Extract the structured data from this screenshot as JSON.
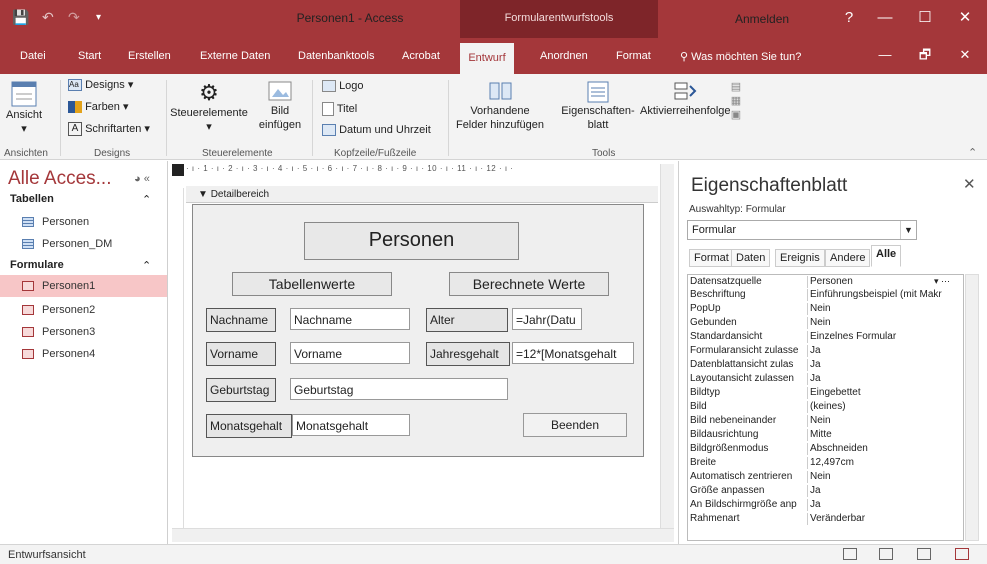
{
  "app": {
    "title": "Personen1 - Access",
    "context_tab_group": "Formularentwurfstools",
    "signin": "Anmelden",
    "help": "?",
    "minimize": "—",
    "restore": "☐",
    "close": "✕",
    "ribbon_restore": "🗗",
    "ribbon_close": "✕"
  },
  "tabs": [
    "Datei",
    "Start",
    "Erstellen",
    "Externe Daten",
    "Datenbanktools",
    "Acrobat",
    "Entwurf",
    "Anordnen",
    "Format"
  ],
  "tell_me": "Was möchten Sie tun?",
  "ribbon": {
    "ansicht": "Ansicht",
    "designs": "Designs",
    "farben": "Farben",
    "schriftarten": "Schriftarten",
    "steuerelemente": "Steuerelemente",
    "bild": "Bild",
    "einfuegen": "einfügen",
    "logo": "Logo",
    "titel": "Titel",
    "datum": "Datum und Uhrzeit",
    "vorhandene1": "Vorhandene",
    "vorhandene2": "Felder hinzufügen",
    "eigenschaften1": "Eigenschaften-",
    "eigenschaften2": "blatt",
    "aktivierreihenfolge": "Aktivierreihenfolge",
    "groups": {
      "ansichten": "Ansichten",
      "designs": "Designs",
      "steuerelemente": "Steuerelemente",
      "kopfzeile": "Kopfzeile/Fußzeile",
      "tools": "Tools"
    }
  },
  "nav": {
    "title": "Alle Acces...",
    "tables_header": "Tabellen",
    "tables": [
      "Personen",
      "Personen_DM"
    ],
    "forms_header": "Formulare",
    "forms": [
      "Personen1",
      "Personen2",
      "Personen3",
      "Personen4"
    ],
    "selected": "Personen1"
  },
  "design": {
    "ruler": "· ı · 1 · ı · 2 · ı · 3 · ı · 4 · ı · 5 · ı · 6 · ı · 7 · ı · 8 · ı · 9 · ı · 10 · ı · 11 · ı · 12 · ı ·",
    "section": "Detailbereich",
    "form_title": "Personen",
    "hdr_left": "Tabellenwerte",
    "hdr_right": "Berechnete Werte",
    "labels": {
      "nachname": "Nachname",
      "vorname": "Vorname",
      "geburtstag": "Geburtstag",
      "monatsgehalt": "Monatsgehalt",
      "alter": "Alter",
      "jahresgehalt": "Jahresgehalt"
    },
    "fields": {
      "nachname": "Nachname",
      "vorname": "Vorname",
      "geburtstag": "Geburtstag",
      "monatsgehalt": "Monatsgehalt",
      "alter": "=Jahr(Datu",
      "jahresgehalt": "=12*[Monatsgehalt"
    },
    "beenden": "Beenden"
  },
  "props": {
    "title": "Eigenschaftenblatt",
    "selection_type": "Auswahltyp: Formular",
    "selected_object": "Formular",
    "tabs": [
      "Format",
      "Daten",
      "Ereignis",
      "Andere",
      "Alle"
    ],
    "active_tab": "Alle",
    "rows": [
      {
        "name": "Datensatzquelle",
        "value": "Personen"
      },
      {
        "name": "Beschriftung",
        "value": "Einführungsbeispiel (mit Makr"
      },
      {
        "name": "PopUp",
        "value": "Nein"
      },
      {
        "name": "Gebunden",
        "value": "Nein"
      },
      {
        "name": "Standardansicht",
        "value": "Einzelnes Formular"
      },
      {
        "name": "Formularansicht zulasse",
        "value": "Ja"
      },
      {
        "name": "Datenblattansicht zulas",
        "value": "Ja"
      },
      {
        "name": "Layoutansicht zulassen",
        "value": "Ja"
      },
      {
        "name": "Bildtyp",
        "value": "Eingebettet"
      },
      {
        "name": "Bild",
        "value": "(keines)"
      },
      {
        "name": "Bild nebeneinander",
        "value": "Nein"
      },
      {
        "name": "Bildausrichtung",
        "value": "Mitte"
      },
      {
        "name": "Bildgrößenmodus",
        "value": "Abschneiden"
      },
      {
        "name": "Breite",
        "value": "12,497cm"
      },
      {
        "name": "Automatisch zentrieren",
        "value": "Nein"
      },
      {
        "name": "Größe anpassen",
        "value": "Ja"
      },
      {
        "name": "An Bildschirmgröße anp",
        "value": "Ja"
      },
      {
        "name": "Rahmenart",
        "value": "Veränderbar"
      }
    ]
  },
  "status": "Entwurfsansicht",
  "colors": {
    "accent": "#a4373a",
    "context": "#7e2529",
    "selected_nav": "#f7c6c7"
  }
}
